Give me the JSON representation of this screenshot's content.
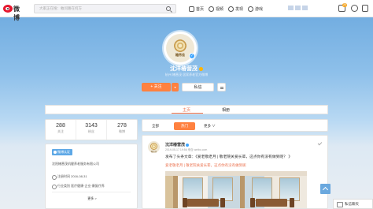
{
  "topbar": {
    "logo_text": "微博",
    "search_placeholder": "大家正在搜：敢问路在何方",
    "nav": [
      {
        "label": "首页",
        "icon": "home-icon"
      },
      {
        "label": "视频",
        "icon": "video-icon"
      },
      {
        "label": "发现",
        "icon": "discover-icon"
      },
      {
        "label": "游戏",
        "icon": "game-icon"
      }
    ],
    "notification_count": "20"
  },
  "profile": {
    "avatar_brand": "糖芾佳",
    "name": "沈洋椿营茂",
    "description": "杭州 椿营茂 居家养老官方微博",
    "follow_label": "+ 关注",
    "message_label": "私信"
  },
  "tabs": {
    "home_label": "主页",
    "album_label": "相册"
  },
  "stats": [
    {
      "num": "288",
      "label": "关注"
    },
    {
      "num": "3143",
      "label": "粉丝"
    },
    {
      "num": "278",
      "label": "微博"
    }
  ],
  "info": {
    "badge": "微博认证",
    "org": "沈阳椿营茂机健养老服务有限公司",
    "register_time": "注册时间 2016-08-31",
    "industry": "行业类别  医疗健康·企业·康复疗养",
    "more": "更多 >"
  },
  "feed": {
    "tab_all": "全部",
    "tab_hot": "热门",
    "tab_more": "更多 ∨"
  },
  "post": {
    "avatar_brand": "糖芾佳",
    "author": "沈洋椿营茂",
    "time": "2019-05-17 19:56 来自 weibo.com",
    "text": "发布了头条文章：《爱老敬老月 | 敬老院关爱长辈，这点你有没有做到呢？ 》",
    "link": "爱老敬老月 | 敬老院关爱长辈，这点你有没有做到呢"
  },
  "chat": {
    "label": "私信聊天"
  },
  "colors": {
    "accent": "#ff8140",
    "link": "#eb7350",
    "sky": "#6aa8de"
  }
}
